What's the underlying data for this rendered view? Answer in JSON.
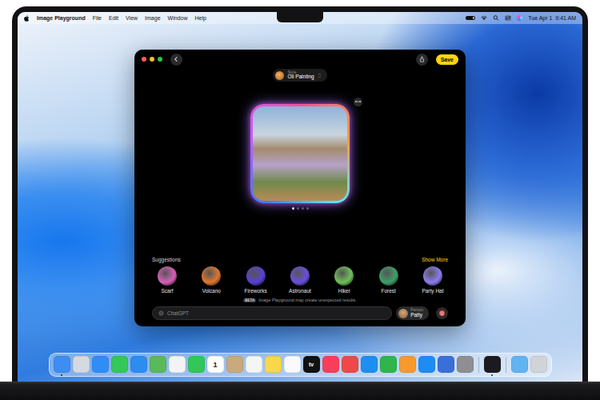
{
  "menu_bar": {
    "app": "Image Playground",
    "items": [
      "File",
      "Edit",
      "View",
      "Image",
      "Window",
      "Help"
    ],
    "clock": "Tue Apr 1  9:41 AM"
  },
  "window": {
    "style_label": "Style",
    "style_value": "Oil Painting",
    "save": "Save",
    "pages": [
      {
        "selected": true
      },
      {
        "selected": false
      },
      {
        "selected": false
      },
      {
        "selected": false
      }
    ]
  },
  "suggestions": {
    "title": "Suggestions",
    "show_more": "Show More",
    "items": [
      {
        "label": "Scarf",
        "color": "#d65fb5"
      },
      {
        "label": "Volcano",
        "color": "#e0762f"
      },
      {
        "label": "Fireworks",
        "color": "#5b3fd1"
      },
      {
        "label": "Astronaut",
        "color": "#6a4fe0"
      },
      {
        "label": "Hiker",
        "color": "#6fbf5a"
      },
      {
        "label": "Forest",
        "color": "#3fa06a"
      },
      {
        "label": "Party Hat",
        "color": "#8a7cf0"
      }
    ]
  },
  "notice": {
    "badge": "BETA",
    "text": "Image Playground may create unexpected results."
  },
  "prompt": {
    "placeholder": "ChatGPT"
  },
  "person": {
    "label": "Person",
    "name": "Patty"
  },
  "dock": {
    "sections": [
      {
        "items": [
          {
            "color": "#3d8ef0",
            "glyph": "",
            "running": true
          },
          {
            "color": "#d5dae0",
            "glyph": "",
            "running": false
          },
          {
            "color": "#2f8df5",
            "glyph": "",
            "running": false
          },
          {
            "color": "#34c759",
            "glyph": "",
            "running": false
          },
          {
            "color": "#2d8cf0",
            "glyph": "",
            "running": false
          },
          {
            "color": "#5ab95a",
            "glyph": "",
            "running": false
          },
          {
            "color": "#f3f3f3",
            "glyph": "",
            "running": false
          },
          {
            "color": "#33c659",
            "glyph": "",
            "running": false
          },
          {
            "color": "#ffffff",
            "glyph": "1",
            "running": false
          },
          {
            "color": "#c9a97d",
            "glyph": "",
            "running": false
          },
          {
            "color": "#f5f5f5",
            "glyph": "",
            "running": false
          },
          {
            "color": "#f8d84a",
            "glyph": "",
            "running": false
          },
          {
            "color": "#fafafa",
            "glyph": "",
            "running": false
          },
          {
            "color": "#111111",
            "glyph": "tv",
            "running": false
          },
          {
            "color": "#fa3e5a",
            "glyph": "",
            "running": false
          },
          {
            "color": "#f04848",
            "glyph": "",
            "running": false
          },
          {
            "color": "#1e8ef0",
            "glyph": "",
            "running": false
          },
          {
            "color": "#2fb54a",
            "glyph": "",
            "running": false
          },
          {
            "color": "#f79a2c",
            "glyph": "",
            "running": false
          },
          {
            "color": "#1f8cf3",
            "glyph": "",
            "running": false
          },
          {
            "color": "#3a6fd8",
            "glyph": "",
            "running": false
          },
          {
            "color": "#8e8e93",
            "glyph": "",
            "running": false
          }
        ]
      },
      {
        "items": [
          {
            "color": "#1b1b1f",
            "glyph": "",
            "running": true
          }
        ]
      },
      {
        "items": [
          {
            "color": "#62b4f0",
            "glyph": "",
            "running": false
          },
          {
            "color": "#d0d4d8",
            "glyph": "",
            "running": false
          }
        ]
      }
    ]
  }
}
